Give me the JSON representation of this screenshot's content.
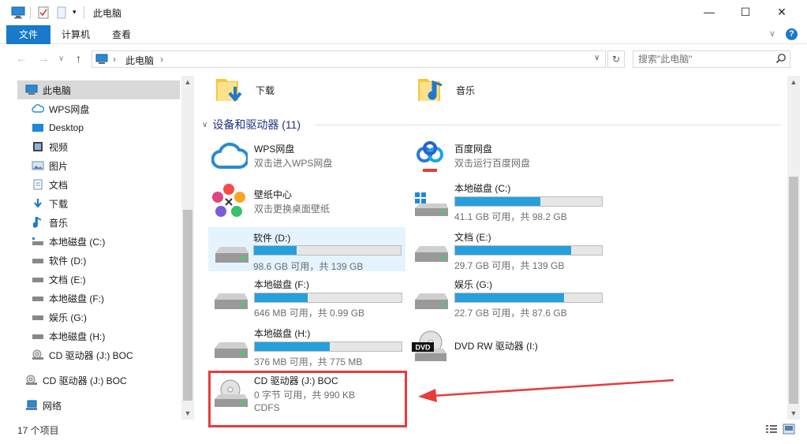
{
  "window": {
    "title": "此电脑",
    "minimize": "—",
    "maximize": "☐",
    "close": "✕"
  },
  "ribbon": {
    "tabs": [
      {
        "label": "文件"
      },
      {
        "label": "计算机"
      },
      {
        "label": "查看"
      }
    ]
  },
  "address": {
    "path": "此电脑",
    "search_placeholder": "搜索\"此电脑\""
  },
  "nav": {
    "items": [
      {
        "label": "此电脑",
        "icon": "computer-icon"
      },
      {
        "label": "WPS网盘",
        "icon": "cloud-icon"
      },
      {
        "label": "Desktop",
        "icon": "desktop-icon"
      },
      {
        "label": "视频",
        "icon": "video-icon"
      },
      {
        "label": "图片",
        "icon": "picture-icon"
      },
      {
        "label": "文档",
        "icon": "document-icon"
      },
      {
        "label": "下载",
        "icon": "download-icon"
      },
      {
        "label": "音乐",
        "icon": "music-icon"
      },
      {
        "label": "本地磁盘 (C:)",
        "icon": "system-drive-icon"
      },
      {
        "label": "软件 (D:)",
        "icon": "drive-icon"
      },
      {
        "label": "文档 (E:)",
        "icon": "drive-icon"
      },
      {
        "label": "本地磁盘 (F:)",
        "icon": "drive-icon"
      },
      {
        "label": "娱乐 (G:)",
        "icon": "drive-icon"
      },
      {
        "label": "本地磁盘 (H:)",
        "icon": "drive-icon"
      },
      {
        "label": "CD 驱动器 (J:) BOC",
        "icon": "cd-drive-icon"
      },
      {
        "label": "CD 驱动器 (J:) BOC",
        "icon": "cd-drive-icon"
      },
      {
        "label": "网络",
        "icon": "network-icon"
      }
    ]
  },
  "folders": [
    {
      "name": "下载",
      "icon": "download-folder-icon"
    },
    {
      "name": "音乐",
      "icon": "music-folder-icon"
    }
  ],
  "group": {
    "title": "设备和驱动器 (11)"
  },
  "devices": [
    {
      "name": "WPS网盘",
      "sub": "双击进入WPS网盘",
      "icon": "wps-cloud-icon"
    },
    {
      "name": "百度网盘",
      "sub": "双击运行百度网盘",
      "icon": "baidu-netdisk-icon"
    },
    {
      "name": "壁纸中心",
      "sub": "双击更换桌面壁纸",
      "icon": "wallpaper-center-icon"
    },
    {
      "name": "本地磁盘 (C:)",
      "sub": "41.1 GB 可用，共 98.2 GB",
      "usage": 0.58,
      "icon": "system-drive-icon"
    },
    {
      "name": "软件 (D:)",
      "sub": "98.6 GB 可用，共 139 GB",
      "usage": 0.29,
      "icon": "drive-icon"
    },
    {
      "name": "文档 (E:)",
      "sub": "29.7 GB 可用，共 139 GB",
      "usage": 0.79,
      "icon": "drive-icon"
    },
    {
      "name": "本地磁盘 (F:)",
      "sub": "646 MB 可用，共 0.99 GB",
      "usage": 0.36,
      "icon": "drive-icon"
    },
    {
      "name": "娱乐 (G:)",
      "sub": "22.7 GB 可用，共 87.6 GB",
      "usage": 0.74,
      "icon": "drive-icon"
    },
    {
      "name": "本地磁盘 (H:)",
      "sub": "376 MB 可用，共 775 MB",
      "usage": 0.51,
      "icon": "drive-icon"
    },
    {
      "name": "DVD RW 驱动器 (I:)",
      "sub": "",
      "icon": "dvd-drive-icon"
    },
    {
      "name": "CD 驱动器 (J:) BOC",
      "sub": "0 字节 可用，共 990 KB",
      "sub2": "CDFS",
      "icon": "cd-drive-icon"
    }
  ],
  "status": {
    "count": "17 个项目"
  },
  "colors": {
    "accent": "#1979ca",
    "bar_fill": "#26a0da",
    "annotation": "#e83b3b"
  }
}
